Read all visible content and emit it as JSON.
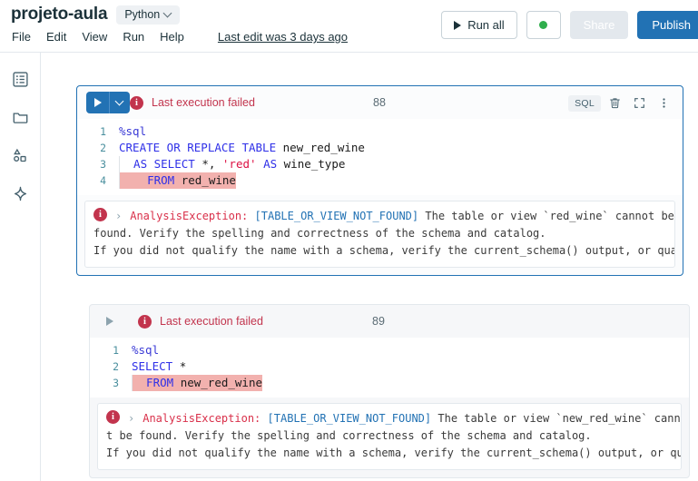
{
  "header": {
    "notebook_title": "projeto-aula",
    "language": "Python",
    "menus": [
      "File",
      "Edit",
      "View",
      "Run",
      "Help"
    ],
    "last_edit": "Last edit was 3 days ago",
    "run_all_label": "Run all",
    "share_label": "Share",
    "publish_label": "Publish",
    "cluster_status_color": "#2fae4c"
  },
  "sidebar": {
    "items": [
      {
        "name": "toc-icon",
        "label": "Table of contents"
      },
      {
        "name": "folder-icon",
        "label": "Workspace"
      },
      {
        "name": "data-shapes-icon",
        "label": "Data"
      },
      {
        "name": "sparkle-icon",
        "label": "Assistant"
      }
    ]
  },
  "cells": [
    {
      "id": "cell-1",
      "selected": true,
      "execution_status": "Last execution failed",
      "execution_number": "88",
      "language_badge": "SQL",
      "code_lines": [
        {
          "num": "1",
          "tokens": [
            {
              "t": "%sql",
              "c": "mg"
            }
          ]
        },
        {
          "num": "2",
          "tokens": [
            {
              "t": "CREATE OR REPLACE TABLE ",
              "c": "kw"
            },
            {
              "t": "new_red_wine",
              "c": "pl"
            }
          ]
        },
        {
          "num": "3",
          "indent_guide": true,
          "tokens": [
            {
              "t": "  AS SELECT ",
              "c": "kw"
            },
            {
              "t": "*",
              "c": "pl"
            },
            {
              "t": ", ",
              "c": "pl"
            },
            {
              "t": "'red'",
              "c": "str"
            },
            {
              "t": " AS ",
              "c": "kw"
            },
            {
              "t": "wine_type",
              "c": "pl"
            }
          ]
        },
        {
          "num": "4",
          "indent_guide": true,
          "error": true,
          "tokens": [
            {
              "t": "    FROM ",
              "c": "kw"
            },
            {
              "t": "red_wine",
              "c": "pl"
            }
          ]
        }
      ],
      "output": {
        "exception": "AnalysisException:",
        "error_code": "[TABLE_OR_VIEW_NOT_FOUND]",
        "line1_rest": " The table or view `red_wine` cannot be",
        "line2": "found. Verify the spelling and correctness of the schema and catalog.",
        "line3": "If you did not qualify the name with a schema, verify the current_schema() output, or qua…"
      }
    },
    {
      "id": "cell-2",
      "selected": false,
      "execution_status": "Last execution failed",
      "execution_number": "89",
      "language_badge": "",
      "code_lines": [
        {
          "num": "1",
          "tokens": [
            {
              "t": "%sql",
              "c": "mg"
            }
          ]
        },
        {
          "num": "2",
          "tokens": [
            {
              "t": "SELECT ",
              "c": "kw"
            },
            {
              "t": "*",
              "c": "pl"
            }
          ]
        },
        {
          "num": "3",
          "indent_guide": true,
          "error": true,
          "tokens": [
            {
              "t": "  FROM ",
              "c": "kw"
            },
            {
              "t": "new_red_wine",
              "c": "pl"
            }
          ]
        }
      ],
      "output": {
        "exception": "AnalysisException:",
        "error_code": "[TABLE_OR_VIEW_NOT_FOUND]",
        "line1_rest": " The table or view `new_red_wine` canno",
        "line2": "t be found. Verify the spelling and correctness of the schema and catalog.",
        "line3": "If you did not qualify the name with a schema, verify the current_schema() output, or qua…"
      }
    }
  ]
}
